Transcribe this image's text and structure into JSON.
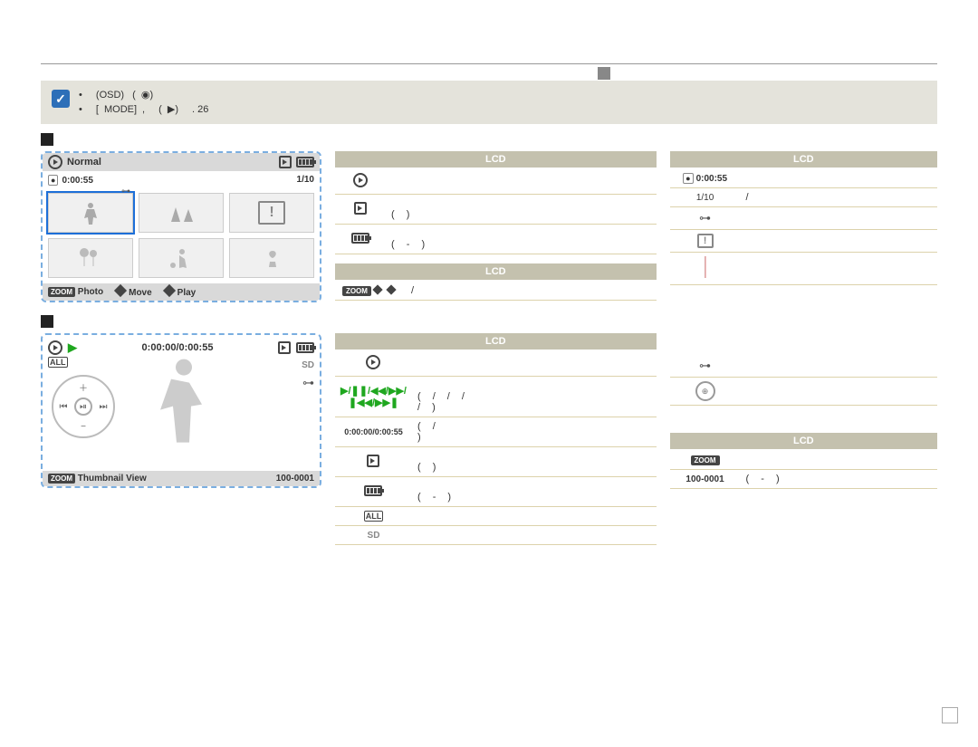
{
  "note": {
    "line1_osd": "(OSD)",
    "line2_mode": "MODE",
    "line2_tail": ". 26"
  },
  "thumb_screen": {
    "mode_label": "Normal",
    "rec_time_badge": "0:00:55",
    "counter": "1/10",
    "menu_zoom": "ZOOM",
    "menu_photo": "Photo",
    "menu_move": "Move",
    "menu_play": "Play"
  },
  "single_screen": {
    "time": "0:00:00/0:00:55",
    "sd_label": "SD",
    "all_label": "ALL",
    "footer_zoom": "ZOOM",
    "footer_thumb": "Thumbnail View",
    "file_no": "100-0001"
  },
  "lcd_label": "LCD",
  "legend_a": [
    {
      "text": ""
    },
    {
      "text": ""
    },
    {
      "text": ""
    }
  ],
  "legend_b": {
    "t1": "0:00:55",
    "t2": "1/10"
  },
  "legend_d": {
    "time": "0:00:00/0:00:55"
  },
  "legend_f": {
    "zoom": "ZOOM",
    "file": "100-0001"
  }
}
